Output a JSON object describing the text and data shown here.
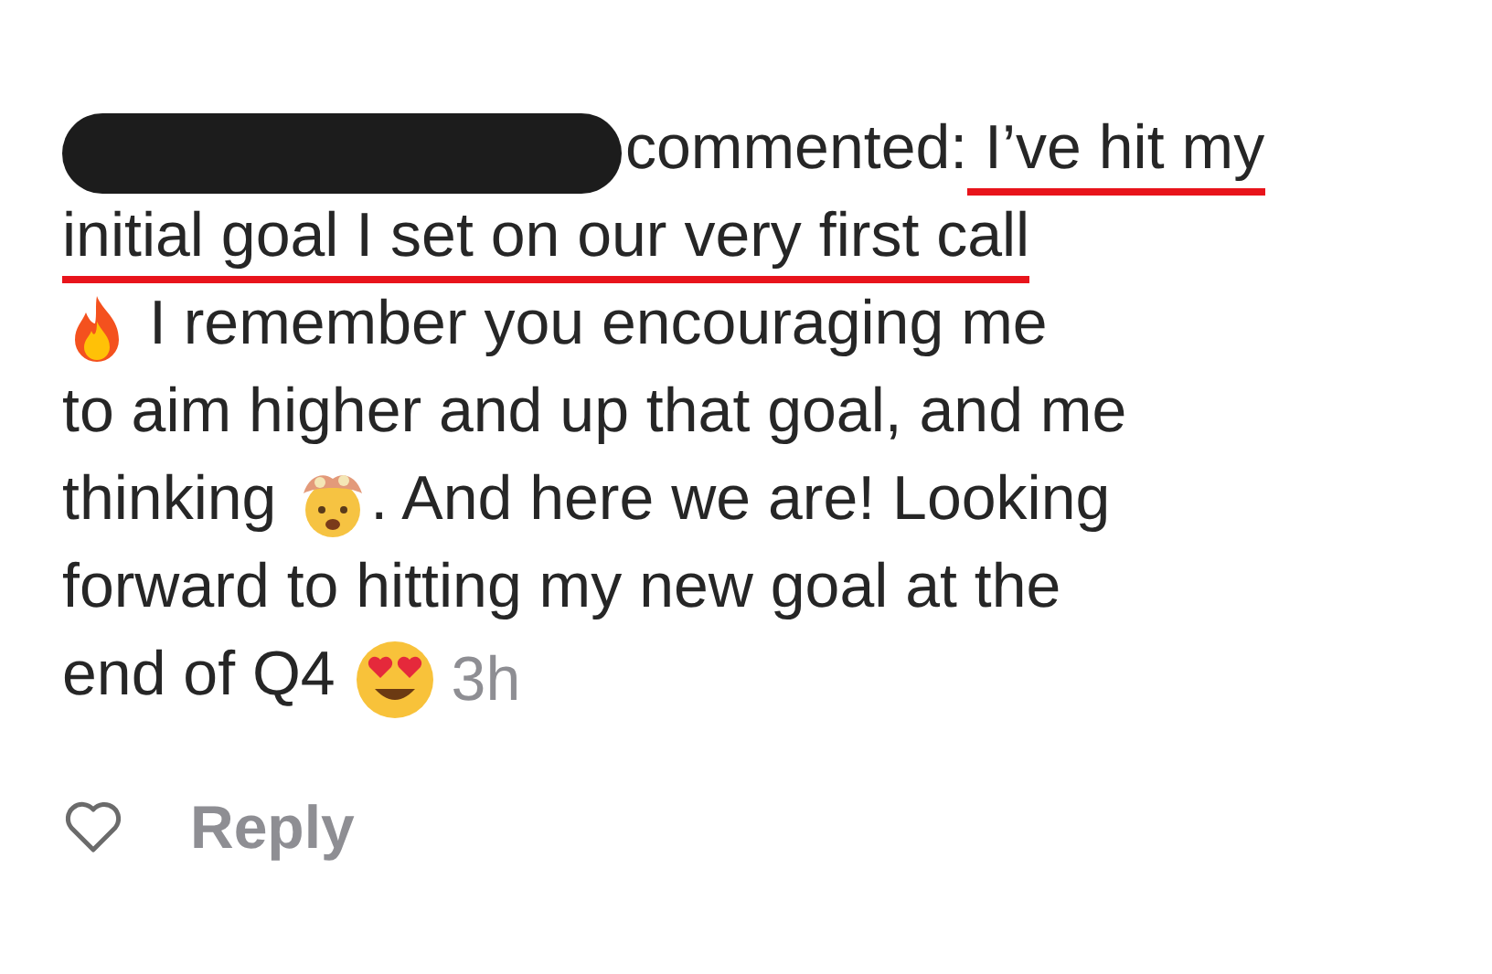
{
  "comment": {
    "lines": [
      [
        {
          "kind": "redaction"
        },
        {
          "kind": "text",
          "text": "commented:",
          "underlined": false
        },
        {
          "kind": "text",
          "text": " I’ve hit my",
          "underlined": true
        }
      ],
      [
        {
          "kind": "text",
          "text": "initial goal I set on our very first call",
          "underlined": true
        }
      ],
      [
        {
          "kind": "fire"
        },
        {
          "kind": "text",
          "text": " I remember you encouraging me",
          "underlined": false
        }
      ],
      [
        {
          "kind": "text",
          "text": "to aim higher and up that goal, and me",
          "underlined": false
        }
      ],
      [
        {
          "kind": "text",
          "text": "thinking ",
          "underlined": false
        },
        {
          "kind": "exploding-head"
        },
        {
          "kind": "text",
          "text": ". And here we are! Looking",
          "underlined": false
        }
      ],
      [
        {
          "kind": "text",
          "text": "forward to hitting my new goal at the",
          "underlined": false
        }
      ],
      [
        {
          "kind": "text",
          "text": "end of Q4 ",
          "underlined": false
        },
        {
          "kind": "heart-eyes"
        },
        {
          "kind": "time",
          "text": "3h"
        }
      ]
    ]
  },
  "actions": {
    "liked": false,
    "reply": "Reply"
  }
}
